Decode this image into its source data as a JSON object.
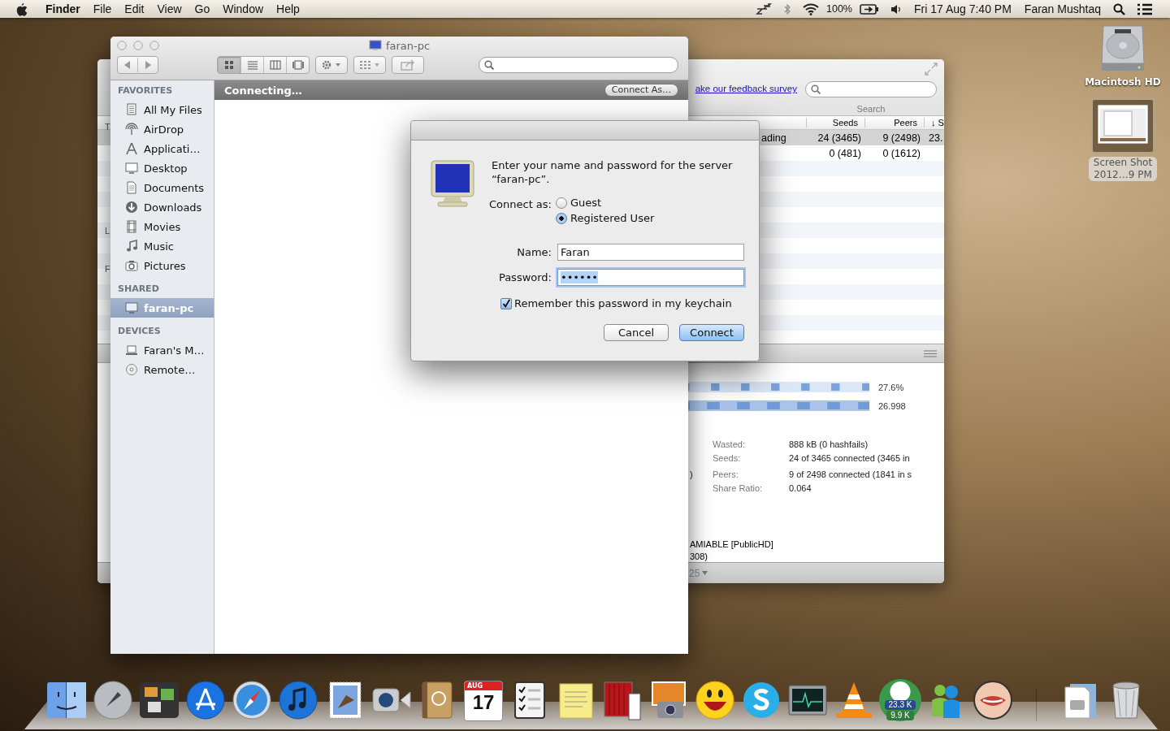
{
  "menu_bar": {
    "app": "Finder",
    "menus": [
      "File",
      "Edit",
      "View",
      "Go",
      "Window",
      "Help"
    ],
    "battery": "100%",
    "clock": "Fri 17 Aug  7:40 PM",
    "user": "Faran Mushtaq"
  },
  "torrent_window": {
    "left_edge_letters": [
      "T",
      "L",
      "F"
    ],
    "link": "ake our feedback survey",
    "search_label": "Search",
    "columns": [
      "Seeds",
      "Peers",
      "↓ S"
    ],
    "rows": [
      {
        "status": "ading",
        "seeds": "24 (3465)",
        "peers": "9 (2498)",
        "down": "23.",
        "selected": true
      },
      {
        "seeds": "0 (481)",
        "peers": "0 (1612)",
        "selected": false
      }
    ],
    "bars": [
      {
        "reading": "27.6%"
      },
      {
        "reading": "26.998"
      }
    ],
    "info": [
      {
        "label": "Wasted:",
        "value": "888 kB (0 hashfails)"
      },
      {
        "label": "Seeds:",
        "value": "24 of 3465 connected (3465 in"
      },
      {
        "prefix": ")",
        "label": "Peers:",
        "value": "9 of 2498 connected (1841 in s"
      },
      {
        "label": "Share Ratio:",
        "value": "0.064"
      }
    ],
    "lines": [
      "AMIABLE [PublicHD]",
      "308)"
    ],
    "footer": "25"
  },
  "finder": {
    "title": "faran-pc",
    "view_buttons": [
      {
        "selected": true
      },
      {
        "selected": false
      },
      {
        "selected": false
      },
      {
        "selected": false
      }
    ],
    "path_status": "Connecting…",
    "connect_as_button": "Connect As…",
    "sections": [
      {
        "title": "FAVORITES",
        "items": [
          {
            "label": "All My Files",
            "selected": false
          },
          {
            "label": "AirDrop",
            "selected": false
          },
          {
            "label": "Applicati…",
            "selected": false
          },
          {
            "label": "Desktop",
            "selected": false
          },
          {
            "label": "Documents",
            "selected": false
          },
          {
            "label": "Downloads",
            "selected": false
          },
          {
            "label": "Movies",
            "selected": false
          },
          {
            "label": "Music",
            "selected": false
          },
          {
            "label": "Pictures",
            "selected": false
          }
        ]
      },
      {
        "title": "SHARED",
        "items": [
          {
            "label": "faran-pc",
            "selected": true
          }
        ]
      },
      {
        "title": "DEVICES",
        "items": [
          {
            "label": "Faran's M…",
            "selected": false
          },
          {
            "label": "Remote…",
            "selected": false
          }
        ]
      }
    ]
  },
  "dialog": {
    "message": "Enter your name and password for the server “faran-pc”.",
    "connect_as_label": "Connect as:",
    "options": [
      {
        "label": "Guest",
        "selected": false
      },
      {
        "label": "Registered User",
        "selected": true
      }
    ],
    "name_label": "Name:",
    "name_value": "Faran",
    "password_label": "Password:",
    "password_value": "••••••",
    "remember": {
      "label": "Remember this password in my keychain",
      "checked": true
    },
    "buttons": [
      {
        "label": "Cancel",
        "default": false
      },
      {
        "label": "Connect",
        "default": true
      }
    ]
  },
  "desktop_icons": [
    {
      "kind": "disk",
      "lines": [
        "Macintosh HD"
      ],
      "selected": false
    },
    {
      "kind": "screenshot",
      "lines": [
        "Screen Shot",
        "2012…9 PM"
      ],
      "selected": true
    }
  ],
  "dock": {
    "calendar": {
      "month": "AUG",
      "day": "17"
    },
    "torrent_badges": [
      "23.3 K",
      "9.9 K"
    ]
  }
}
